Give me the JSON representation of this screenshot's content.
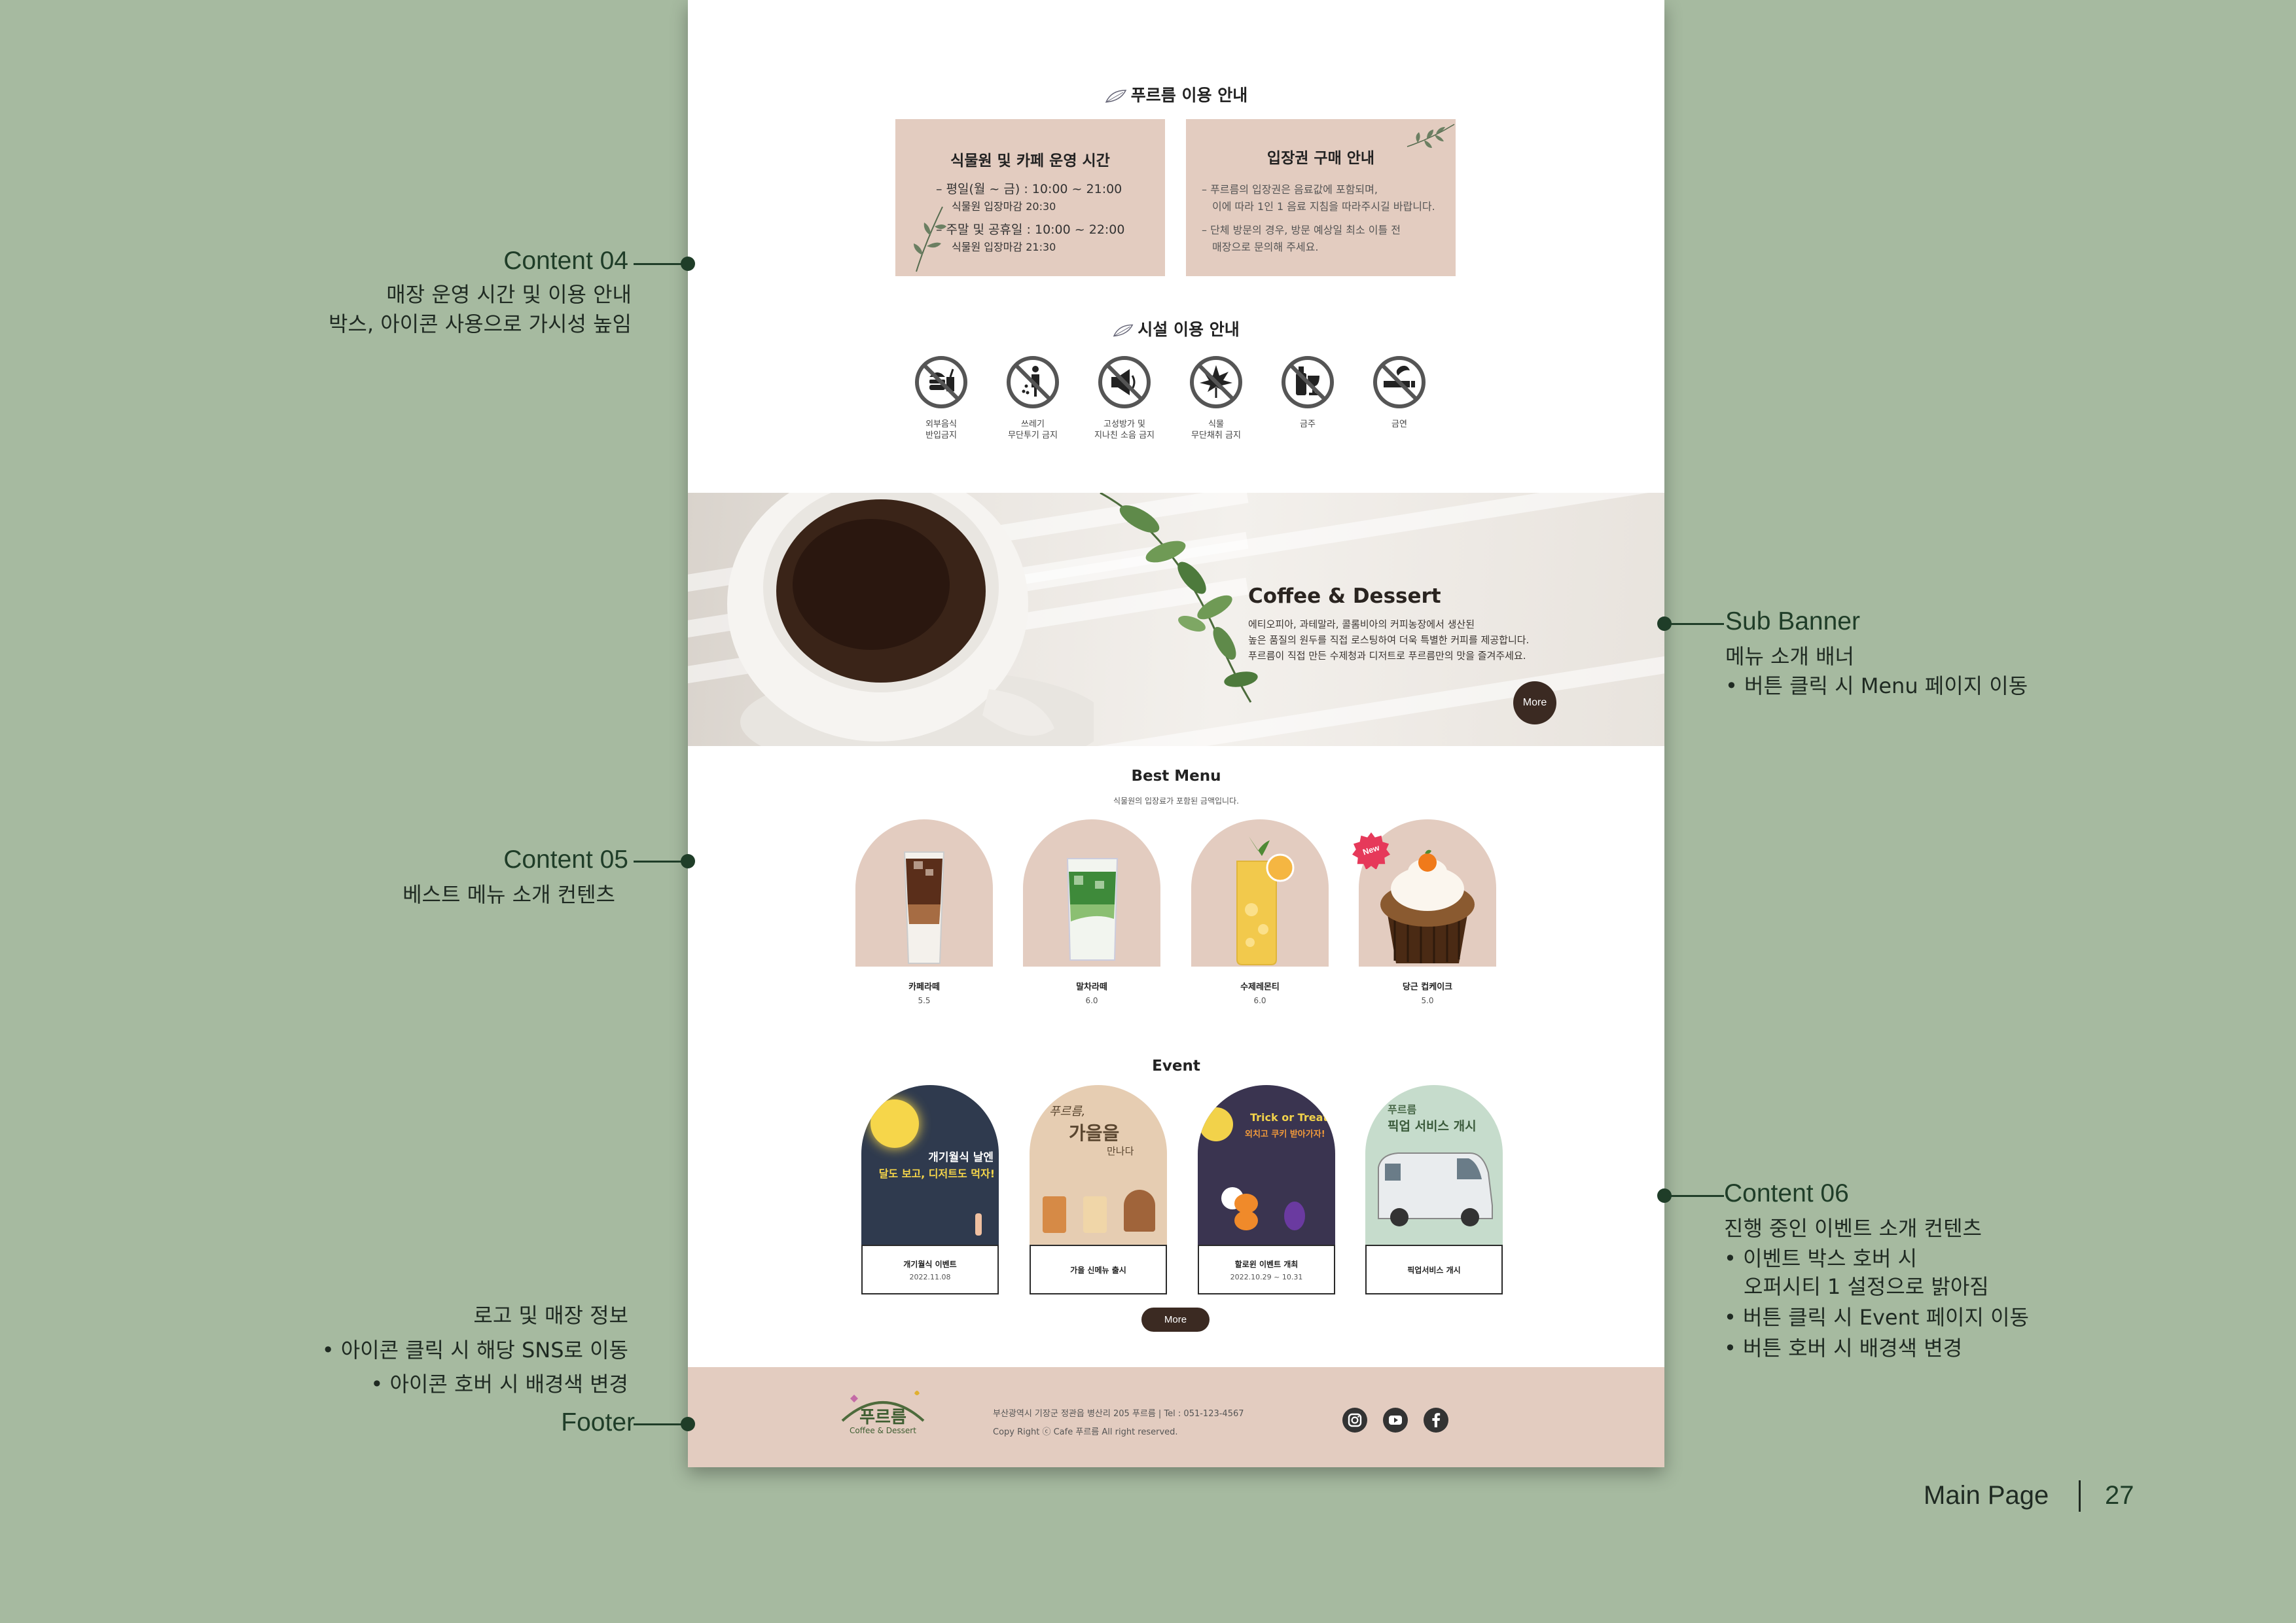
{
  "guide": {
    "title": "푸르름 이용 안내",
    "hours_box": {
      "title": "식물원 및 카페 운영 시간",
      "weekday": "– 평일(월 ~ 금) : 10:00 ~ 21:00",
      "weekday_last": "식물원 입장마감 20:30",
      "weekend": "– 주말 및 공휴일 : 10:00 ~ 22:00",
      "weekend_last": "식물원 입장마감 21:30"
    },
    "ticket_box": {
      "title": "입장권 구매 안내",
      "line1": "– 푸르름의 입장권은 음료값에 포함되며,",
      "line2": "이에 따라 1인 1 음료 지침을 따라주시길 바랍니다.",
      "line3": "– 단체 방문의 경우, 방문 예상일 최소 이틀 전",
      "line4": "매장으로 문의해 주세요."
    }
  },
  "facility": {
    "title": "시설 이용 안내",
    "items": [
      {
        "icon": "no-outside-food-icon",
        "label": "외부음식\n반입금지"
      },
      {
        "icon": "no-littering-icon",
        "label": "쓰레기\n무단투기 금지"
      },
      {
        "icon": "no-loud-noise-icon",
        "label": "고성방가 및\n지나친 소음 금지"
      },
      {
        "icon": "no-plant-picking-icon",
        "label": "식물\n무단채취 금지"
      },
      {
        "icon": "no-alcohol-icon",
        "label": "금주"
      },
      {
        "icon": "no-smoking-icon",
        "label": "금연"
      }
    ]
  },
  "banner": {
    "title": "Coffee & Dessert",
    "desc1": "에티오피아, 과테말라, 콜롬비아의 커피농장에서 생산된",
    "desc2": "높은 품질의 원두를 직접 로스팅하여 더욱 특별한 커피를 제공합니다.",
    "desc3": "푸르름이 직접 만든 수제청과 디저트로 푸르름만의 맛을 즐겨주세요.",
    "more_label": "More"
  },
  "best_menu": {
    "title": "Best Menu",
    "subtitle": "식물원의 입장료가 포함된 금액입니다.",
    "items": [
      {
        "name": "카페라떼",
        "price": "5.5"
      },
      {
        "name": "말차라떼",
        "price": "6.0"
      },
      {
        "name": "수제레몬티",
        "price": "6.0"
      },
      {
        "name": "당근 컵케이크",
        "price": "5.0",
        "badge": "New"
      }
    ]
  },
  "event": {
    "title": "Event",
    "items": [
      {
        "title": "개기월식 이벤트",
        "date": "2022.11.08",
        "poster_lines": [
          "개기월식 날엔",
          "달도 보고, 디저트도 먹자!"
        ]
      },
      {
        "title": "가을 신메뉴 출시",
        "date": "",
        "poster_lines": [
          "푸르름,",
          "가을을",
          "만나다"
        ]
      },
      {
        "title": "할로윈 이벤트 개최",
        "date": "2022.10.29 ~ 10.31",
        "poster_lines": [
          "Trick or Treat!",
          "외치고 쿠키 받아가자!"
        ]
      },
      {
        "title": "픽업서비스 개시",
        "date": "",
        "poster_lines": [
          "푸르름",
          "픽업 서비스 개시"
        ]
      }
    ],
    "more_label": "More"
  },
  "footer": {
    "logo_text": "푸르름",
    "logo_sub": "Coffee & Dessert",
    "address": "부산광역시 기장군 정관읍 병산리 205 푸르름  |  Tel : 051-123-4567",
    "copyright": "Copy Right ⓒ Cafe 푸르름 All right reserved.",
    "sns": [
      "instagram-icon",
      "youtube-icon",
      "facebook-icon"
    ]
  },
  "annotations": {
    "content04": {
      "heading": "Content 04",
      "line1": "매장 운영 시간 및 이용 안내",
      "line2": "박스, 아이콘 사용으로 가시성 높임"
    },
    "content05": {
      "heading": "Content 05",
      "line1": "베스트 메뉴 소개 컨텐츠"
    },
    "footer": {
      "heading": "Footer",
      "line1": "로고 및 매장 정보",
      "line2": "• 아이콘 클릭 시 해당 SNS로 이동",
      "line3": "• 아이콘 호버 시 배경색 변경"
    },
    "sub_banner": {
      "heading": "Sub Banner",
      "line1": "메뉴 소개 배너",
      "line2": "• 버튼 클릭 시 Menu 페이지 이동"
    },
    "content06": {
      "heading": "Content 06",
      "line1": "진행 중인 이벤트 소개 컨텐츠",
      "line2": "• 이벤트 박스 호버 시",
      "line3": "오퍼시티 1 설정으로 밝아짐",
      "line4": "• 버튼 클릭 시 Event 페이지 이동",
      "line5": "• 버튼 호버 시 배경색 변경"
    }
  },
  "page_ref": {
    "label": "Main Page",
    "number": "27"
  }
}
